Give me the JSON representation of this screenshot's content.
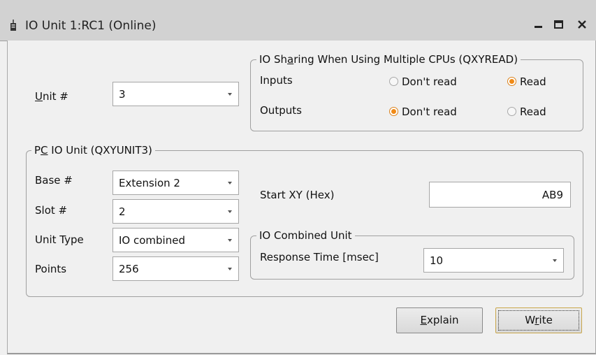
{
  "window": {
    "title": "IO Unit 1:RC1 (Online)"
  },
  "unit": {
    "label_mnemonic": "U",
    "label_rest": "nit #",
    "value": "3"
  },
  "io_sharing": {
    "legend_before": "IO Sh",
    "legend_mnemonic": "a",
    "legend_after": "ring When Using Multiple CPUs (QXYREAD)",
    "rows": [
      {
        "label": "Inputs",
        "option1": "Don't read",
        "option2": "Read",
        "selected": "Read"
      },
      {
        "label": "Outputs",
        "option1": "Don't read",
        "option2": "Read",
        "selected": "Don't read"
      }
    ]
  },
  "pc_io": {
    "legend_before": "P",
    "legend_mnemonic": "C",
    "legend_after": " IO Unit (QXYUNIT3)",
    "base_label": "Base #",
    "base_value": "Extension 2",
    "slot_label": "Slot #",
    "slot_value": "2",
    "type_label": "Unit Type",
    "type_value": "IO combined",
    "points_label": "Points",
    "points_value": "256",
    "start_label": "Start XY (Hex)",
    "start_value": "AB9"
  },
  "io_combined": {
    "legend": "IO Combined Unit",
    "response_label": "Response Time [msec]",
    "response_value": "10"
  },
  "buttons": {
    "explain_mnemonic": "E",
    "explain_rest": "xplain",
    "write_before": "W",
    "write_mnemonic": "r",
    "write_after": "ite"
  },
  "colors": {
    "radio_selected": "#f08a16",
    "titlebar": "#d2d2d2",
    "background": "#f0f0f0"
  }
}
